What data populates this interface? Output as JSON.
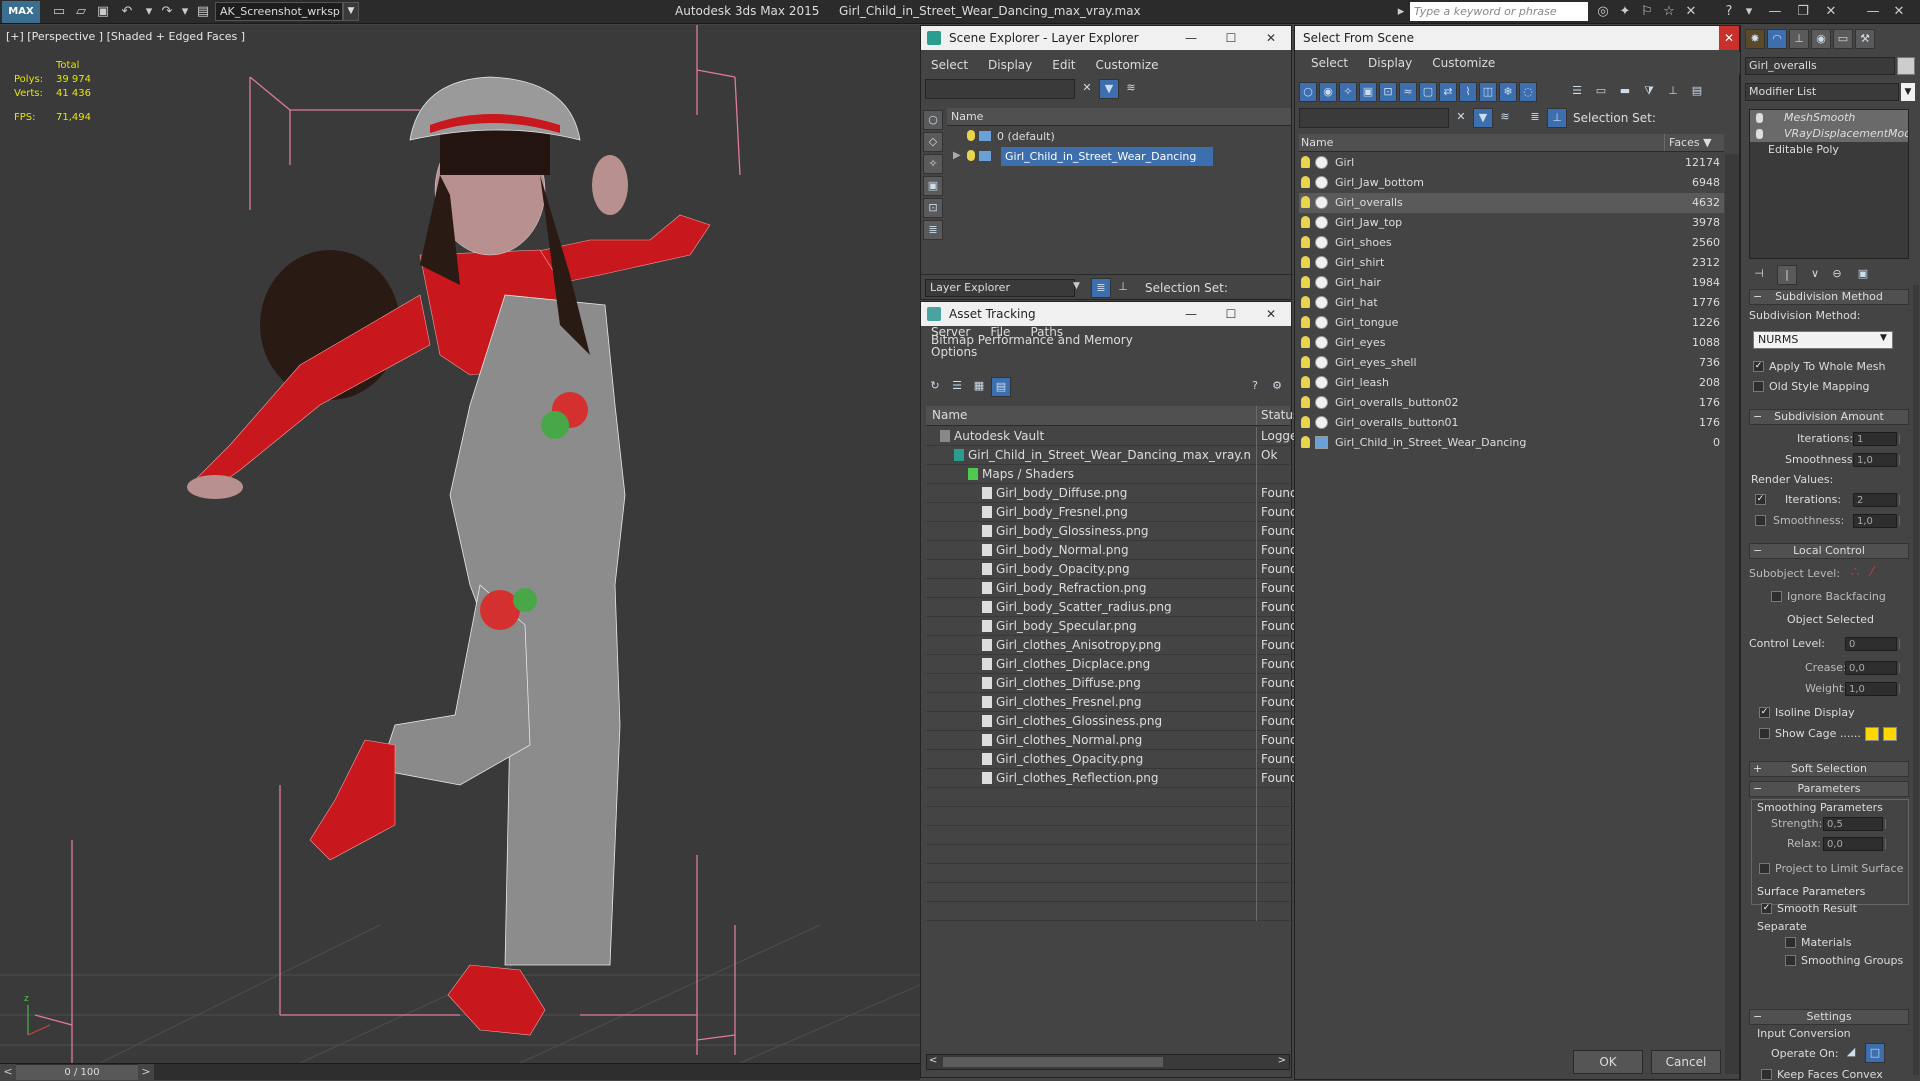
{
  "titlebar": {
    "workspace": "AK_Screenshot_wrksp",
    "app_name": "Autodesk 3ds Max  2015",
    "file_name": "Girl_Child_in_Street_Wear_Dancing_max_vray.max",
    "search_placeholder": "Type a keyword or phrase",
    "logo_text": "MAX"
  },
  "viewport": {
    "label": "[+] [Perspective ] [Shaded + Edged Faces ]",
    "stats": {
      "total_label": "Total",
      "polys_label": "Polys:",
      "polys_value": "39 974",
      "verts_label": "Verts:",
      "verts_value": "41 436",
      "fps_label": "FPS:",
      "fps_value": "71,494"
    },
    "timeline_frame": "0 / 100"
  },
  "scene_explorer": {
    "title": "Scene Explorer - Layer Explorer",
    "menu": [
      "Select",
      "Display",
      "Edit",
      "Customize"
    ],
    "column_name": "Name",
    "layers": [
      {
        "name": "0 (default)",
        "selected": false
      },
      {
        "name": "Girl_Child_in_Street_Wear_Dancing",
        "selected": true
      }
    ],
    "footer_mode": "Layer Explorer",
    "selection_set_label": "Selection Set:"
  },
  "asset_tracking": {
    "title": "Asset Tracking",
    "menu": [
      "Server",
      "File",
      "Paths",
      "Bitmap Performance and Memory",
      "Options"
    ],
    "columns": {
      "name": "Name",
      "status": "Status"
    },
    "rows": [
      {
        "name": "Autodesk Vault",
        "status": "Logged",
        "indent": 1
      },
      {
        "name": "Girl_Child_in_Street_Wear_Dancing_max_vray.max",
        "status": "Ok",
        "indent": 2
      },
      {
        "name": "Maps / Shaders",
        "status": "",
        "indent": 3
      },
      {
        "name": "Girl_body_Diffuse.png",
        "status": "Found",
        "indent": 4
      },
      {
        "name": "Girl_body_Fresnel.png",
        "status": "Found",
        "indent": 4
      },
      {
        "name": "Girl_body_Glossiness.png",
        "status": "Found",
        "indent": 4
      },
      {
        "name": "Girl_body_Normal.png",
        "status": "Found",
        "indent": 4
      },
      {
        "name": "Girl_body_Opacity.png",
        "status": "Found",
        "indent": 4
      },
      {
        "name": "Girl_body_Refraction.png",
        "status": "Found",
        "indent": 4
      },
      {
        "name": "Girl_body_Scatter_radius.png",
        "status": "Found",
        "indent": 4
      },
      {
        "name": "Girl_body_Specular.png",
        "status": "Found",
        "indent": 4
      },
      {
        "name": "Girl_clothes_Anisotropy.png",
        "status": "Found",
        "indent": 4
      },
      {
        "name": "Girl_clothes_Dicplace.png",
        "status": "Found",
        "indent": 4
      },
      {
        "name": "Girl_clothes_Diffuse.png",
        "status": "Found",
        "indent": 4
      },
      {
        "name": "Girl_clothes_Fresnel.png",
        "status": "Found",
        "indent": 4
      },
      {
        "name": "Girl_clothes_Glossiness.png",
        "status": "Found",
        "indent": 4
      },
      {
        "name": "Girl_clothes_Normal.png",
        "status": "Found",
        "indent": 4
      },
      {
        "name": "Girl_clothes_Opacity.png",
        "status": "Found",
        "indent": 4
      },
      {
        "name": "Girl_clothes_Reflection.png",
        "status": "Found",
        "indent": 4
      }
    ]
  },
  "select_from_scene": {
    "title": "Select From Scene",
    "menu": [
      "Select",
      "Display",
      "Customize"
    ],
    "selection_set_label": "Selection Set:",
    "columns": {
      "name": "Name",
      "faces": "Faces"
    },
    "objects": [
      {
        "name": "Girl",
        "faces": "12174"
      },
      {
        "name": "Girl_Jaw_bottom",
        "faces": "6948"
      },
      {
        "name": "Girl_overalls",
        "faces": "4632",
        "selected": true
      },
      {
        "name": "Girl_Jaw_top",
        "faces": "3978"
      },
      {
        "name": "Girl_shoes",
        "faces": "2560"
      },
      {
        "name": "Girl_shirt",
        "faces": "2312"
      },
      {
        "name": "Girl_hair",
        "faces": "1984"
      },
      {
        "name": "Girl_hat",
        "faces": "1776"
      },
      {
        "name": "Girl_tongue",
        "faces": "1226"
      },
      {
        "name": "Girl_eyes",
        "faces": "1088"
      },
      {
        "name": "Girl_eyes_shell",
        "faces": "736"
      },
      {
        "name": "Girl_leash",
        "faces": "208"
      },
      {
        "name": "Girl_overalls_button02",
        "faces": "176"
      },
      {
        "name": "Girl_overalls_button01",
        "faces": "176"
      },
      {
        "name": "Girl_Child_in_Street_Wear_Dancing",
        "faces": "0"
      }
    ],
    "ok_label": "OK",
    "cancel_label": "Cancel"
  },
  "command_panel": {
    "object_name": "Girl_overalls",
    "modifier_list_label": "Modifier List",
    "stack": [
      "MeshSmooth",
      "VRayDisplacementMod",
      "Editable Poly"
    ],
    "subdivision_method": {
      "header": "Subdivision Method",
      "label": "Subdivision Method:",
      "value": "NURMS",
      "apply_whole_mesh": "Apply To Whole Mesh",
      "old_style_mapping": "Old Style Mapping"
    },
    "subdivision_amount": {
      "header": "Subdivision Amount",
      "iterations_label": "Iterations:",
      "iterations_value": "1",
      "smoothness_label": "Smoothness:",
      "smoothness_value": "1,0",
      "render_values_label": "Render Values:",
      "render_iterations_label": "Iterations:",
      "render_iterations_value": "2",
      "render_smoothness_label": "Smoothness:",
      "render_smoothness_value": "1,0"
    },
    "local_control": {
      "header": "Local Control",
      "subobject_label": "Subobject Level:",
      "ignore_backfacing": "Ignore Backfacing",
      "object_selected": "Object Selected",
      "control_level_label": "Control Level:",
      "control_level_value": "0",
      "crease_label": "Crease:",
      "crease_value": "0,0",
      "weight_label": "Weight:",
      "weight_value": "1,0",
      "isoline_display": "Isoline Display",
      "show_cage": "Show Cage ......"
    },
    "soft_selection_header": "Soft Selection",
    "parameters": {
      "header": "Parameters",
      "smoothing_params": "Smoothing Parameters",
      "strength_label": "Strength:",
      "strength_value": "0,5",
      "relax_label": "Relax:",
      "relax_value": "0,0",
      "project_limit": "Project to Limit Surface",
      "surface_params": "Surface Parameters",
      "smooth_result": "Smooth Result",
      "separate_label": "Separate",
      "materials": "Materials",
      "smoothing_groups": "Smoothing Groups"
    },
    "settings": {
      "header": "Settings",
      "input_conversion": "Input Conversion",
      "operate_on": "Operate On:",
      "keep_faces_convex": "Keep Faces Convex"
    }
  },
  "colors": {
    "accent": "#3d6fae",
    "stats_yellow": "#e6e600",
    "grid_pink": "#e07aa0",
    "shirt_red": "#c8181e",
    "cage_yellow": "#ffd700"
  }
}
